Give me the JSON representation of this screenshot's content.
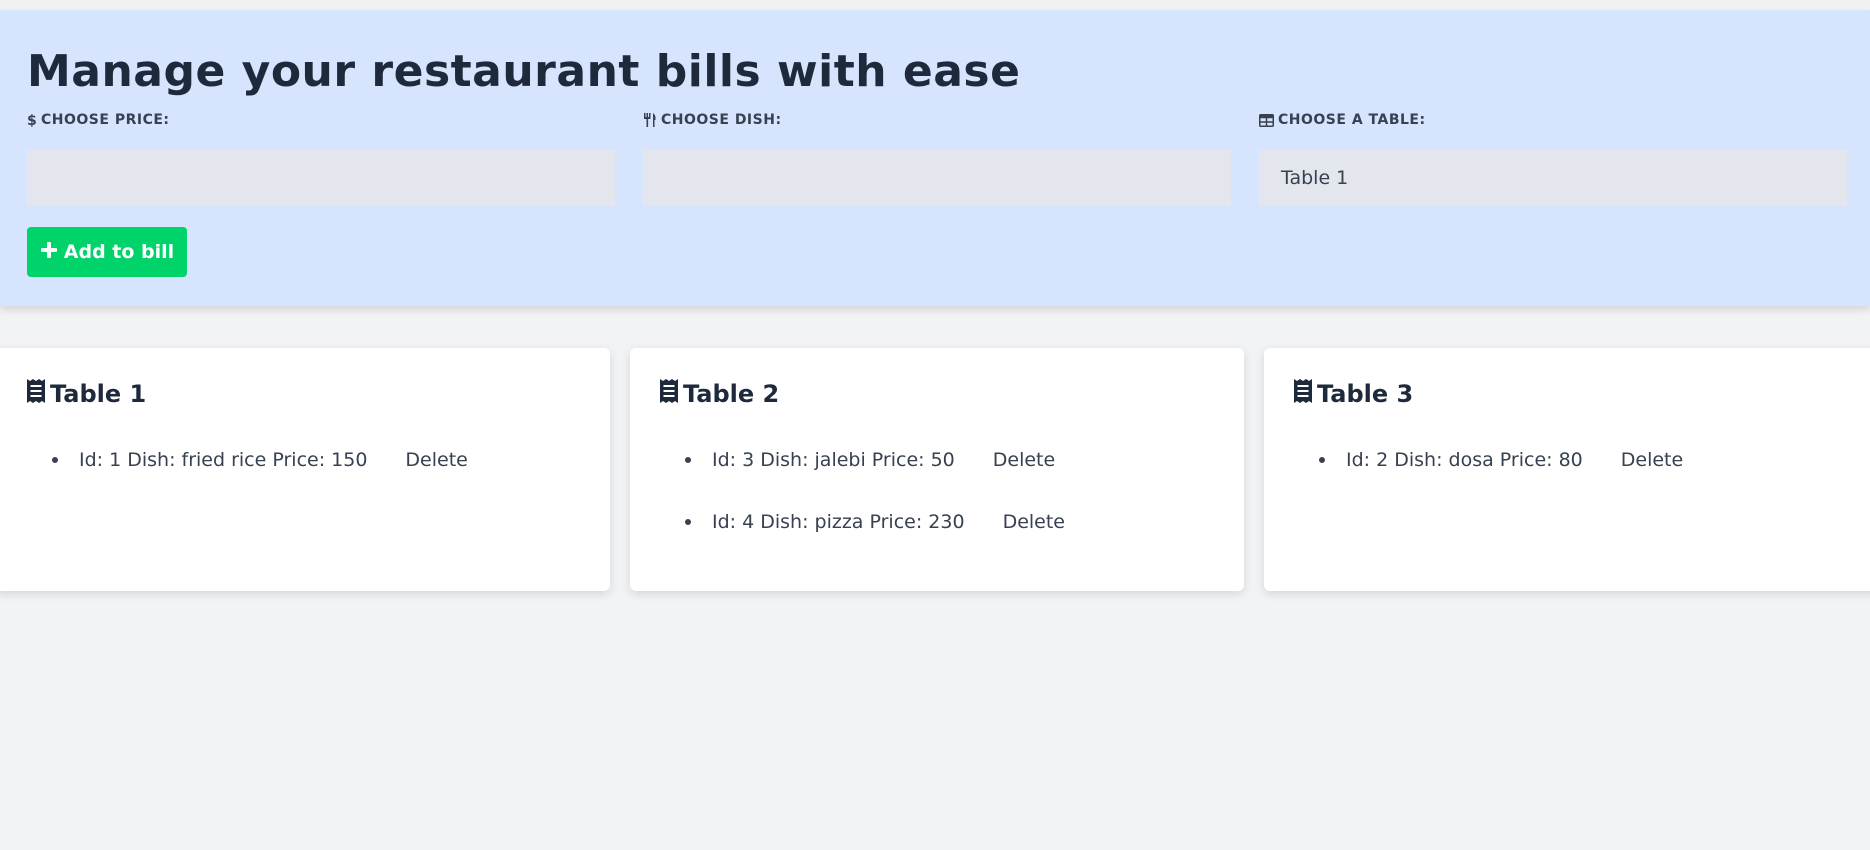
{
  "header": {
    "title": "Manage your restaurant bills with ease",
    "price_label": "CHOOSE PRICE:",
    "price_value": "",
    "dish_label": "CHOOSE DISH:",
    "dish_value": "",
    "table_label": "CHOOSE A TABLE:",
    "table_selected": "Table 1",
    "add_button_label": "Add to bill"
  },
  "colors": {
    "header_bg": "#d6e4fd",
    "accent_green": "#00d36a",
    "page_bg": "#f2f3f5"
  },
  "icons": {
    "price": "dollar-icon",
    "dish": "utensils-icon",
    "table": "table-grid-icon",
    "card": "receipt-icon",
    "add": "plus-icon"
  },
  "tables": [
    {
      "name": "Table 1",
      "items": [
        {
          "text": "Id: 1 Dish: fried rice Price: 150",
          "delete_label": "Delete"
        }
      ]
    },
    {
      "name": "Table 2",
      "items": [
        {
          "text": "Id: 3 Dish: jalebi Price: 50",
          "delete_label": "Delete"
        },
        {
          "text": "Id: 4 Dish: pizza Price: 230",
          "delete_label": "Delete"
        }
      ]
    },
    {
      "name": "Table 3",
      "items": [
        {
          "text": "Id: 2 Dish: dosa Price: 80",
          "delete_label": "Delete"
        }
      ]
    }
  ]
}
